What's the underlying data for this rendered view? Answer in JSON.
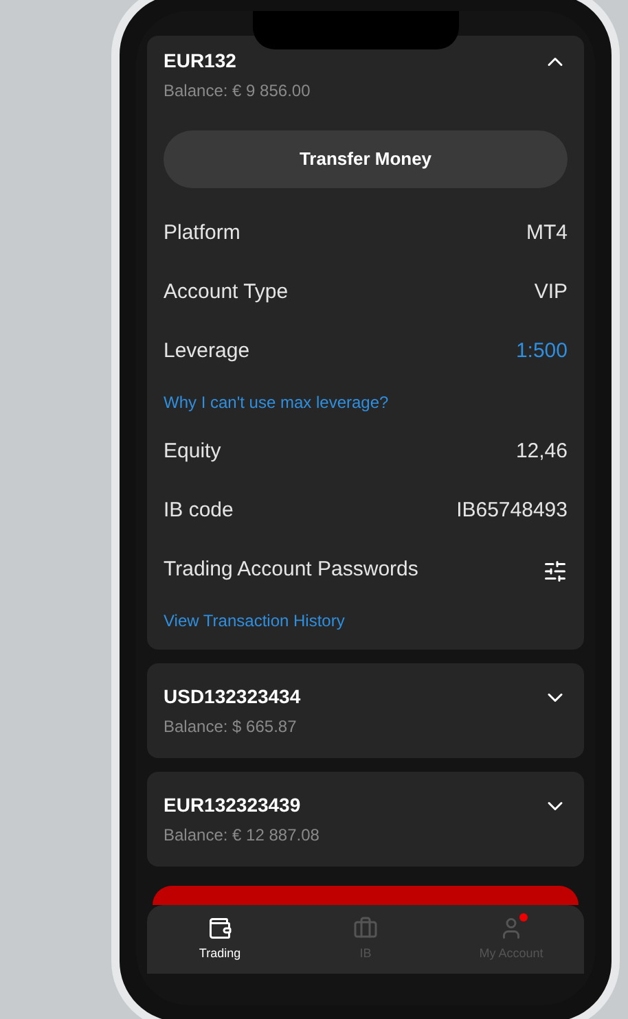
{
  "expanded_account": {
    "name": "EUR132",
    "balance": "Balance: € 9 856.00",
    "expanded": true,
    "transfer_button": "Transfer Money",
    "rows": [
      {
        "kind": "value",
        "label": "Platform",
        "value": "MT4",
        "highlight": false
      },
      {
        "kind": "value",
        "label": "Account Type",
        "value": "VIP",
        "highlight": false
      },
      {
        "kind": "value",
        "label": "Leverage",
        "value": "1:500",
        "highlight": true
      },
      {
        "kind": "link",
        "label": "Why I can't use max leverage?"
      },
      {
        "kind": "value",
        "label": "Equity",
        "value": "12,46",
        "highlight": false
      },
      {
        "kind": "value",
        "label": "IB code",
        "value": "IB65748493",
        "highlight": false
      },
      {
        "kind": "icon",
        "label": "Trading Account Passwords"
      },
      {
        "kind": "link",
        "label": "View Transaction History"
      }
    ]
  },
  "accounts": [
    {
      "name": "USD132323434",
      "balance": "Balance: $ 665.87",
      "expanded": false
    },
    {
      "name": "EUR132323439",
      "balance": "Balance: € 12 887.08",
      "expanded": false
    }
  ],
  "tab_bar": [
    {
      "label": "Trading",
      "selected": true,
      "badge": false
    },
    {
      "label": "IB",
      "selected": false,
      "badge": false
    },
    {
      "label": "My Account",
      "selected": false,
      "badge": true
    }
  ]
}
